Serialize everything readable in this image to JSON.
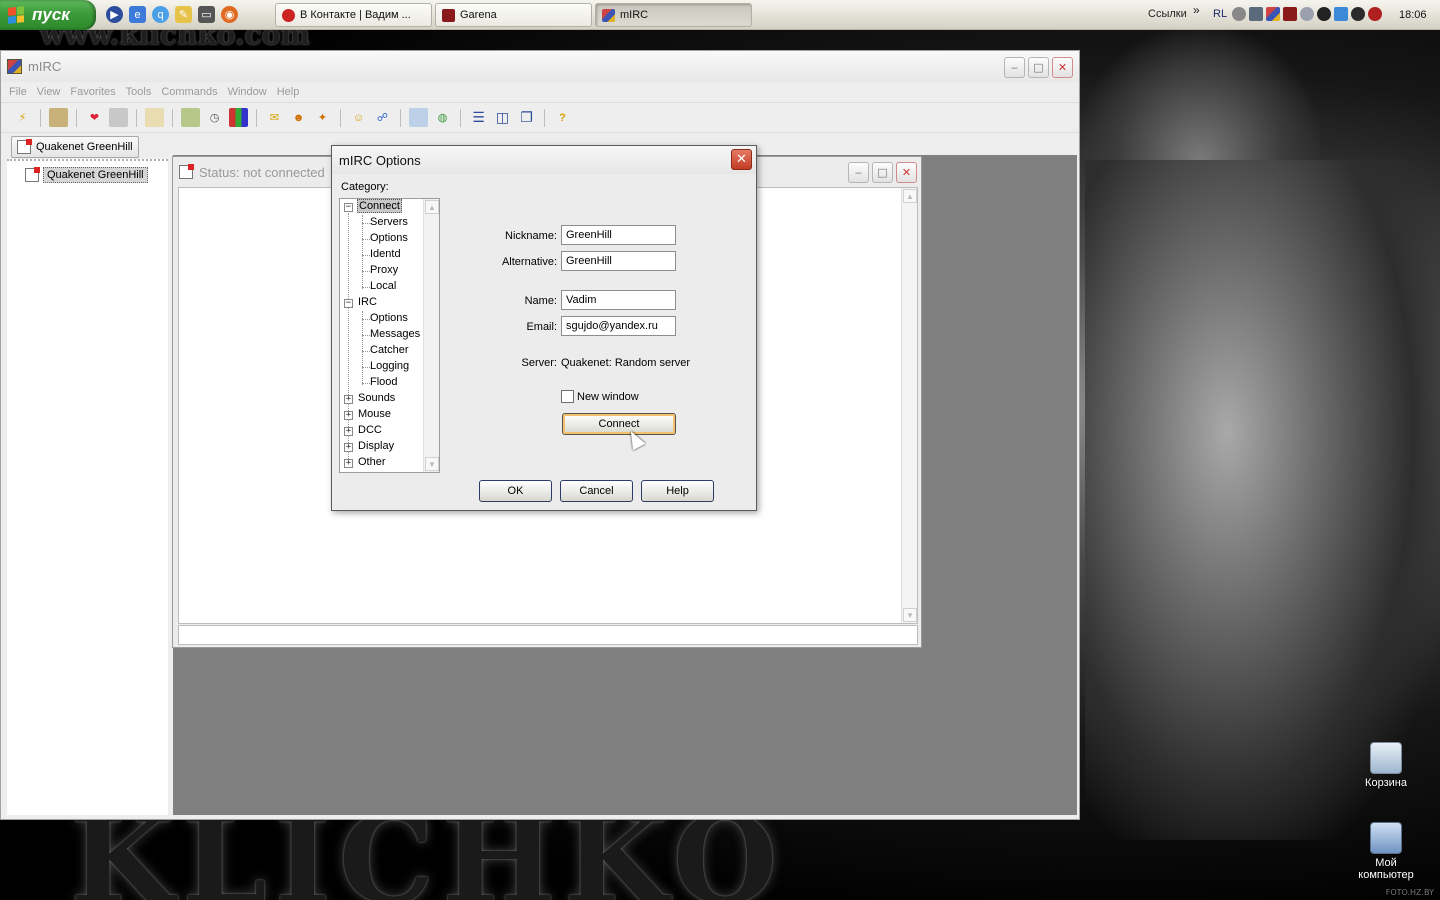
{
  "taskbar": {
    "start_label": "пуск",
    "tasks": [
      {
        "label": "В Контакте | Вадим ..."
      },
      {
        "label": "Garena"
      },
      {
        "label": "mIRC"
      }
    ],
    "links_label": "Ссылки",
    "chevron": "»",
    "language": "RL",
    "clock": "18:06"
  },
  "wallpaper": {
    "url_text": "www.klichko.com",
    "big_text": "KLICHKO",
    "watermark": "FOTO.HZ.BY"
  },
  "desktop_icons": [
    {
      "label": "Корзина"
    },
    {
      "label": "Мой компьютер"
    }
  ],
  "mirc": {
    "title": "mIRC",
    "menu": [
      "File",
      "View",
      "Favorites",
      "Tools",
      "Commands",
      "Window",
      "Help"
    ],
    "switchbar_button": "Quakenet GreenHill",
    "tree_item": "Quakenet GreenHill",
    "status_title": "Status: not connected"
  },
  "dialog": {
    "title": "mIRC Options",
    "category_label": "Category:",
    "tree": {
      "connect": "Connect",
      "connect_children": [
        "Servers",
        "Options",
        "Identd",
        "Proxy",
        "Local"
      ],
      "irc": "IRC",
      "irc_children": [
        "Options",
        "Messages",
        "Catcher",
        "Logging",
        "Flood"
      ],
      "collapsed": [
        "Sounds",
        "Mouse",
        "DCC",
        "Display",
        "Other"
      ]
    },
    "form": {
      "nickname_label": "Nickname:",
      "nickname_value": "GreenHill",
      "alternative_label": "Alternative:",
      "alternative_value": "GreenHill",
      "name_label": "Name:",
      "name_value": "Vadim",
      "email_label": "Email:",
      "email_value": "sgujdo@yandex.ru",
      "server_label": "Server:",
      "server_value": "Quakenet: Random server",
      "new_window_label": "New window",
      "new_window_checked": false,
      "connect_label": "Connect"
    },
    "buttons": {
      "ok": "OK",
      "cancel": "Cancel",
      "help": "Help"
    }
  }
}
